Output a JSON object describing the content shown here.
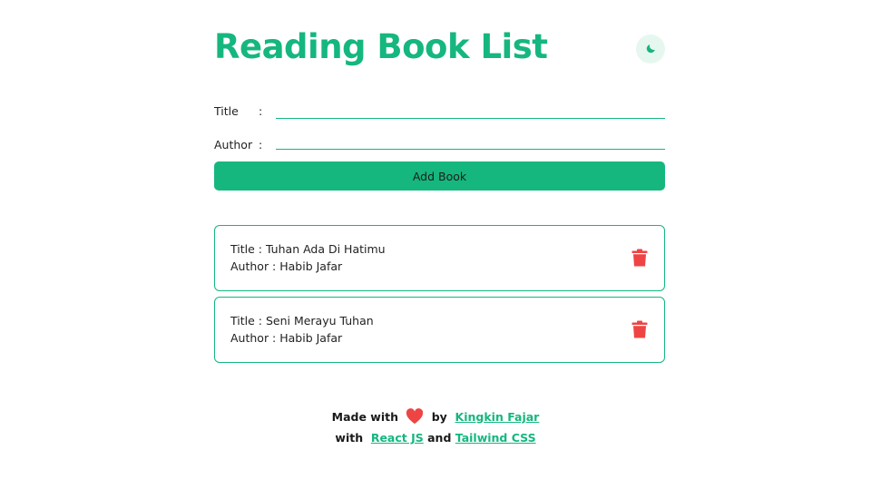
{
  "header": {
    "title": "Reading Book List",
    "theme_toggle_icon": "moon-icon"
  },
  "form": {
    "title_label": "Title",
    "author_label": "Author",
    "colon": ":",
    "title_value": "",
    "author_value": "",
    "add_button_label": "Add Book"
  },
  "books": [
    {
      "title_line": "Title : Tuhan Ada Di Hatimu",
      "author_line": "Author : Habib Jafar",
      "delete_icon": "trash-icon"
    },
    {
      "title_line": "Title : Seni Merayu Tuhan",
      "author_line": "Author : Habib Jafar",
      "delete_icon": "trash-icon"
    }
  ],
  "footer": {
    "made_with": "Made with",
    "heart_icon": "heart-icon",
    "by": "by",
    "author_link": "Kingkin Fajar",
    "with": "with",
    "react_link": "React JS",
    "and": "and",
    "tailwind_link": "Tailwind CSS"
  },
  "colors": {
    "accent": "#15b77e",
    "delete": "#ef4444",
    "heart": "#ef4444",
    "toggle_bg": "#e6f7ef"
  }
}
